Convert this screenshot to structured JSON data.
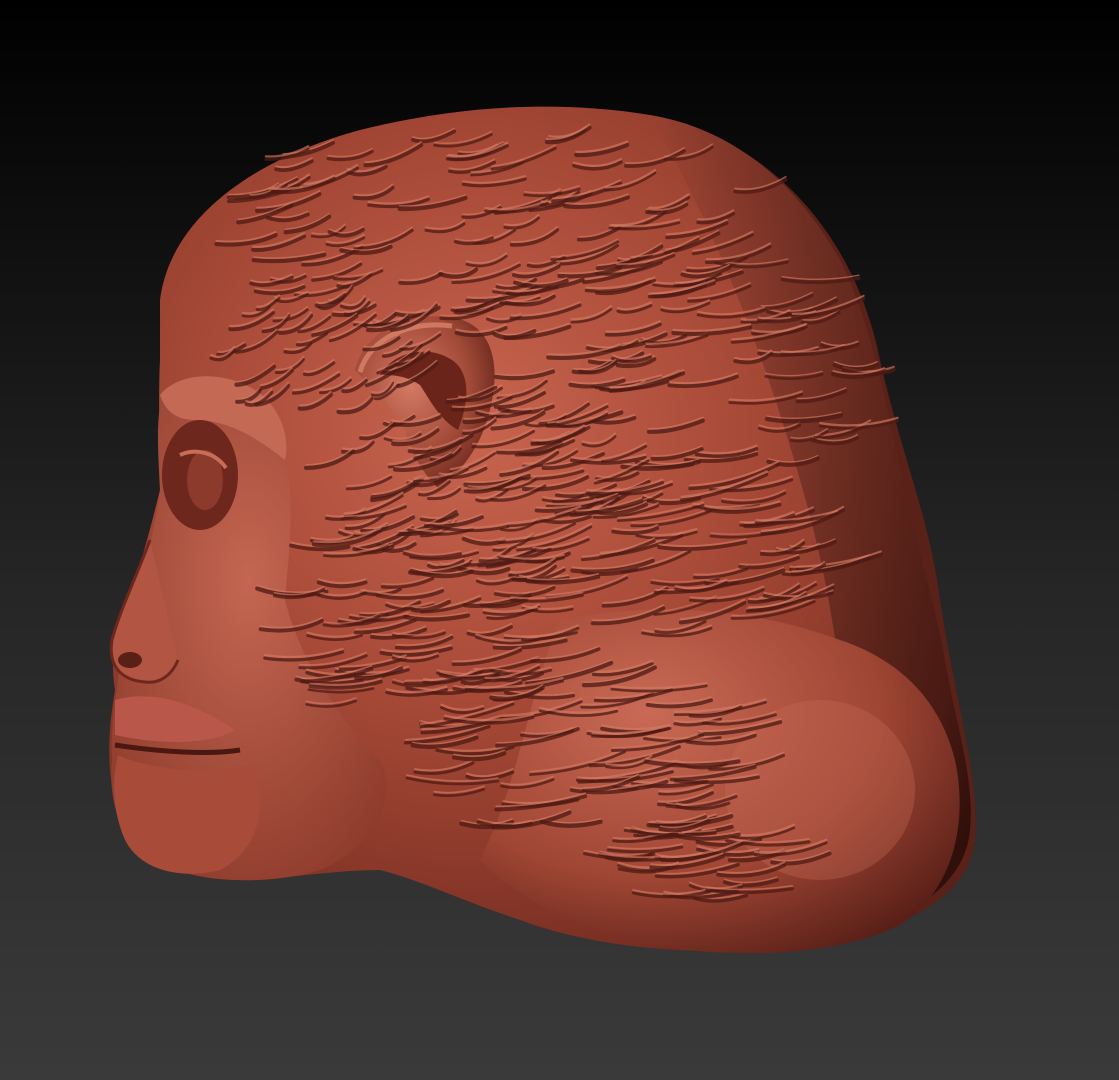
{
  "scene": {
    "subject": "sculpted-primate-head",
    "view": "three-quarter-left-profile",
    "background_gradient": [
      "#000000",
      "#2a2a2a",
      "#393939"
    ],
    "material_colors": {
      "base": "#a64a3a",
      "highlight": "#d2725d",
      "mid": "#8a3a2c",
      "shadow": "#4e1b14",
      "deep_shadow": "#2e0d09"
    }
  }
}
